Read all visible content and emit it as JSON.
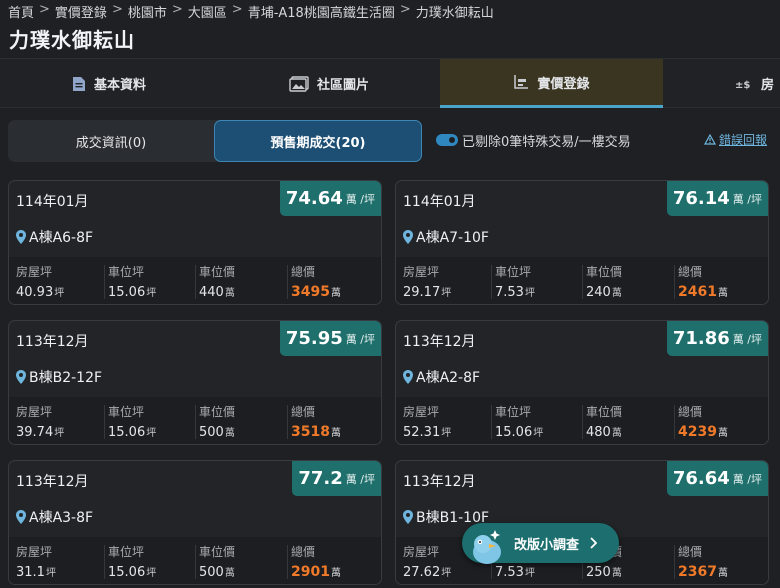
{
  "breadcrumb": [
    "首頁",
    "實價登錄",
    "桃園市",
    "大園區",
    "青埔-A18桃園高鐵生活圈",
    "力璞水御耘山"
  ],
  "page_title": "力璞水御耘山",
  "tabs": [
    {
      "label": "基本資料",
      "icon": "document-icon"
    },
    {
      "label": "社區圖片",
      "icon": "image-icon"
    },
    {
      "label": "實價登錄",
      "icon": "chart-icon",
      "active": true
    },
    {
      "label": "房",
      "icon": "price-icon"
    }
  ],
  "segments": {
    "deal_info": "成交資訊(0)",
    "presale": "預售期成交(20)"
  },
  "toggle_label": "已剔除0筆特殊交易/一樓交易",
  "report_label": "錯誤回報",
  "stat_labels": {
    "house": "房屋坪",
    "parking_area": "車位坪",
    "parking_price": "車位價",
    "total": "總價"
  },
  "units": {
    "per_ping": "萬 /坪",
    "ping": "坪",
    "wan": "萬"
  },
  "cards": [
    {
      "date": "114年01月",
      "price": "74.64",
      "unit": "A棟A6-8F",
      "house": "40.93",
      "parking_area": "15.06",
      "parking_price": "440",
      "total": "3495"
    },
    {
      "date": "114年01月",
      "price": "76.14",
      "unit": "A棟A7-10F",
      "house": "29.17",
      "parking_area": "7.53",
      "parking_price": "240",
      "total": "2461"
    },
    {
      "date": "113年12月",
      "price": "75.95",
      "unit": "B棟B2-12F",
      "house": "39.74",
      "parking_area": "15.06",
      "parking_price": "500",
      "total": "3518"
    },
    {
      "date": "113年12月",
      "price": "71.86",
      "unit": "A棟A2-8F",
      "house": "52.31",
      "parking_area": "15.06",
      "parking_price": "480",
      "total": "4239"
    },
    {
      "date": "113年12月",
      "price": "77.2",
      "unit": "A棟A3-8F",
      "house": "31.1",
      "parking_area": "15.06",
      "parking_price": "500",
      "total": "2901"
    },
    {
      "date": "113年12月",
      "price": "76.64",
      "unit": "B棟B1-10F",
      "house": "27.62",
      "parking_area": "7.53",
      "parking_price": "250",
      "total": "2367"
    }
  ],
  "survey_label": "改版小調查",
  "colors": {
    "accent": "#1f6f6c",
    "total": "#f07a2a",
    "link": "#6fb6de",
    "active_segment": "#1c4f73"
  }
}
